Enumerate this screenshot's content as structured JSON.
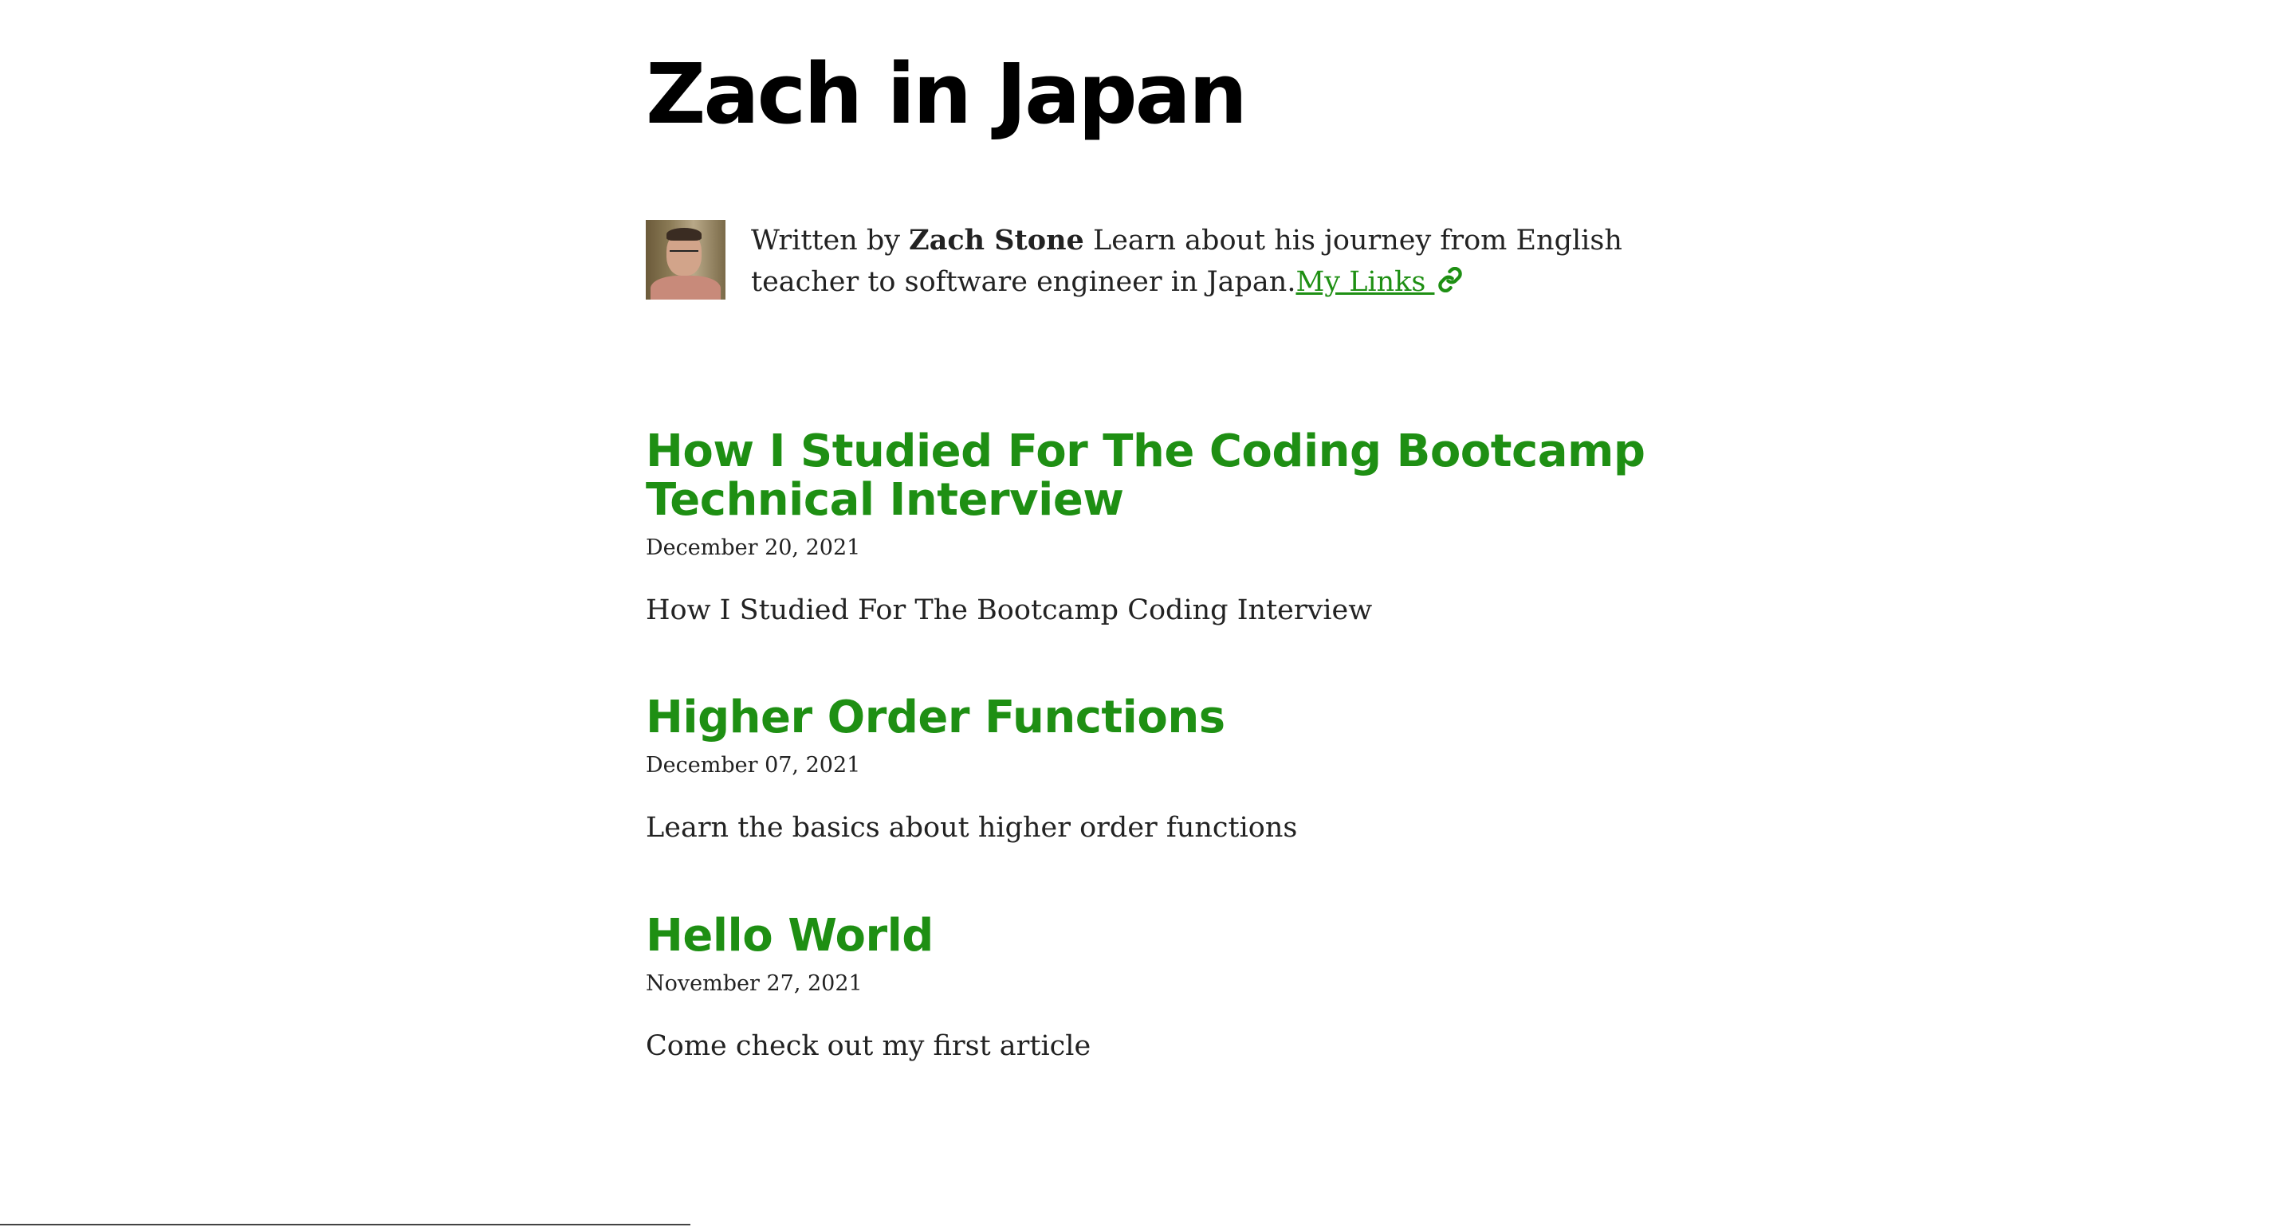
{
  "site": {
    "title": "Zach in Japan"
  },
  "bio": {
    "written_by": "Written by ",
    "author": "Zach Stone",
    "description": " Learn about his journey from English teacher to software engineer in Japan.",
    "link_label": "My Links ",
    "link_icon": "link-icon",
    "avatar_icon": "author-avatar"
  },
  "posts": [
    {
      "title": "How I Studied For The Coding Bootcamp Technical Interview",
      "date": "December 20, 2021",
      "description": "How I Studied For The Bootcamp Coding Interview"
    },
    {
      "title": "Higher Order Functions",
      "date": "December 07, 2021",
      "description": "Learn the basics about higher order functions"
    },
    {
      "title": "Hello World",
      "date": "November 27, 2021",
      "description": "Come check out my first article"
    }
  ],
  "colors": {
    "accent": "#1e8f13",
    "text": "#222222",
    "title": "#000000"
  }
}
